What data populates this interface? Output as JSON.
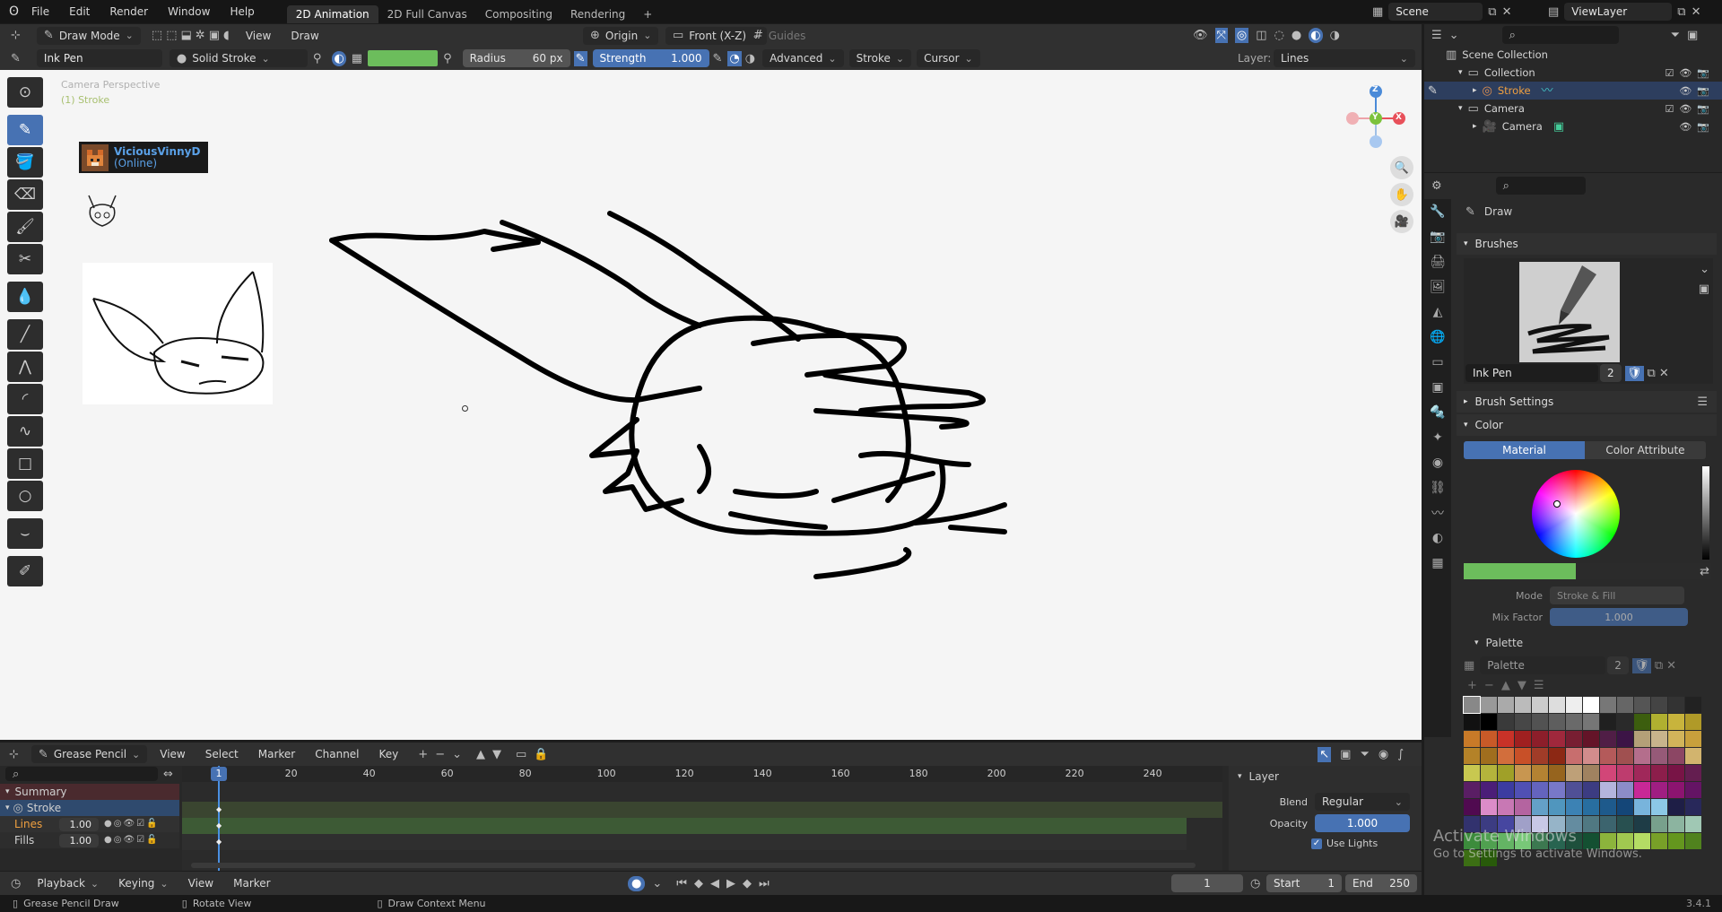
{
  "topbar": {
    "menus": [
      "File",
      "Edit",
      "Render",
      "Window",
      "Help"
    ],
    "workspaces": [
      "2D Animation",
      "2D Full Canvas",
      "Compositing",
      "Rendering"
    ],
    "add_symbol": "+",
    "scene": "Scene",
    "view_layer": "ViewLayer"
  },
  "header1": {
    "mode": "Draw Mode",
    "menus": [
      "View",
      "Draw"
    ],
    "origin": "Origin",
    "front": "Front (X-Z)",
    "guides": "Guides"
  },
  "header2": {
    "brush": "Ink Pen",
    "stroke_type": "Solid Stroke",
    "radius_label": "Radius",
    "radius_value": "60 px",
    "strength_label": "Strength",
    "strength_value": "1.000",
    "advanced": "Advanced",
    "stroke": "Stroke",
    "cursor": "Cursor",
    "layer_label": "Layer:",
    "layer_value": "Lines"
  },
  "viewport": {
    "camera_label": "Camera Perspective",
    "object_label": "(1) Stroke",
    "stream_user": "ViciousVinnyD",
    "stream_status": "(Online)",
    "gizmo": {
      "z": "Z",
      "y": "Y",
      "x": "X"
    }
  },
  "outliner": {
    "root": "Scene Collection",
    "rows": [
      {
        "label": "Collection",
        "indent": 1,
        "selected": false
      },
      {
        "label": "Stroke",
        "indent": 2,
        "selected": true
      },
      {
        "label": "Camera",
        "indent": 1,
        "selected": false
      },
      {
        "label": "Camera",
        "indent": 2,
        "selected": false
      }
    ]
  },
  "properties": {
    "tool_title": "Draw",
    "brushes_label": "Brushes",
    "brush_name": "Ink Pen",
    "brush_users": "2",
    "brush_settings_label": "Brush Settings",
    "color_label": "Color",
    "color_tab_material": "Material",
    "color_tab_attribute": "Color Attribute",
    "mode_label": "Mode",
    "mode_value": "Stroke & Fill",
    "mix_label": "Mix Factor",
    "mix_value": "1.000",
    "palette_label": "Palette",
    "palette_name": "Palette",
    "palette_users": "2",
    "accent": "#6cbd5c",
    "palette_colors": [
      "#888888",
      "#999999",
      "#aaaaaa",
      "#bbbbbb",
      "#cccccc",
      "#dddddd",
      "#eeeeee",
      "#ffffff",
      "#777777",
      "#666666",
      "#555555",
      "#444444",
      "#333333",
      "#222222",
      "#111111",
      "#000000",
      "#3a3a3a",
      "#474747",
      "#525252",
      "#5e5e5e",
      "#6a6a6a",
      "#767676",
      "#202020",
      "#2a2a2a",
      "#3c5e0e",
      "#b0b030",
      "#c8b43c",
      "#b09a28",
      "#c87a28",
      "#c85a28",
      "#c83228",
      "#a02020",
      "#8c1e2a",
      "#a0283c",
      "#781e32",
      "#641428",
      "#501e46",
      "#3c1446",
      "#b4a078",
      "#c8b48c",
      "#d2b45a",
      "#c8a03c",
      "#b48228",
      "#a06e1e",
      "#d26e3c",
      "#c85028",
      "#a03c28",
      "#8c2814",
      "#c86e6e",
      "#d28c8c",
      "#b45a5a",
      "#a05050",
      "#b46e8c",
      "#965a78",
      "#8c4664",
      "#d2b46e",
      "#c8c850",
      "#b4b43c",
      "#a0a028",
      "#c89650",
      "#b48232",
      "#96641e",
      "#bea078",
      "#a08260",
      "#d24678",
      "#be3c6e",
      "#a0285a",
      "#8c1e4b",
      "#781446",
      "#641e50",
      "#5a1e64",
      "#4b1e78",
      "#3c3ca0",
      "#5050b4",
      "#6464be",
      "#7878c8",
      "#505096",
      "#3c3c82",
      "#b4b4dc",
      "#8c8cc8",
      "#c82896",
      "#a01e82",
      "#8c1470",
      "#641464",
      "#500a50",
      "#dc8cc8",
      "#c878b4",
      "#b464a0",
      "#64a0c8",
      "#5096be",
      "#3c82b4",
      "#286ea0",
      "#1e5a8c",
      "#144678",
      "#78b4dc",
      "#8cc8e6",
      "#1e1e46",
      "#28285a",
      "#32326e",
      "#3c3c82",
      "#4646a0",
      "#a0a0c8",
      "#c8c8e6",
      "#96b4c8",
      "#648ca0",
      "#507882",
      "#3c646e",
      "#285050",
      "#1e3c46",
      "#78a08c",
      "#8cb4a0",
      "#a0c8b4",
      "#3c8c3c",
      "#50a050",
      "#64b464",
      "#78c878",
      "#3c7850",
      "#286450",
      "#1e503c",
      "#145032",
      "#8cb43c",
      "#a0c850",
      "#b4dc64",
      "#78a028",
      "#64961e",
      "#50821e",
      "#3c6e14",
      "#285a0a"
    ]
  },
  "dopesheet": {
    "editor": "Grease Pencil",
    "menus": [
      "View",
      "Select",
      "Marker",
      "Channel",
      "Key"
    ],
    "ticks": [
      "1",
      "20",
      "40",
      "60",
      "80",
      "100",
      "120",
      "140",
      "160",
      "180",
      "200",
      "220",
      "240"
    ],
    "channels": {
      "summary": "Summary",
      "stroke": "Stroke",
      "lines": "Lines",
      "lines_val": "1.00",
      "fills": "Fills",
      "fills_val": "1.00"
    },
    "layer_panel": {
      "title": "Layer",
      "blend_label": "Blend",
      "blend_value": "Regular",
      "opacity_label": "Opacity",
      "opacity_value": "1.000",
      "use_lights": "Use Lights"
    }
  },
  "timeline": {
    "menus": [
      "Playback",
      "Keying",
      "View",
      "Marker"
    ],
    "current_frame": "1",
    "start_label": "Start",
    "start_value": "1",
    "end_label": "End",
    "end_value": "250"
  },
  "status": {
    "left": "Grease Pencil Draw",
    "middle": "Rotate View",
    "right": "Draw Context Menu",
    "version": "3.4.1",
    "activate_title": "Activate Windows",
    "activate_sub": "Go to Settings to activate Windows."
  }
}
